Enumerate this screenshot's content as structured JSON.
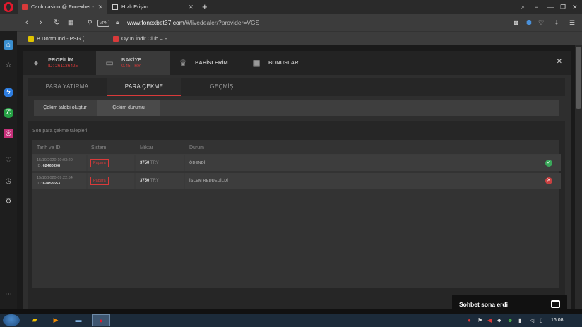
{
  "browser": {
    "tabs": [
      {
        "title": "Canlı casino @ Fonexbet -",
        "active": true
      },
      {
        "title": "Hızlı Erişim",
        "active": false
      }
    ],
    "url_host": "www.fonexbet37.com",
    "url_path": "/#/livedealer/?provider=VGS",
    "vpn_label": "VPN",
    "bookmarks": [
      "B.Dortmund - PSG (...",
      "Oyun İndir Club – F..."
    ]
  },
  "modal": {
    "tabs": [
      {
        "title": "PROFİLİM",
        "subtitle": "ID: 261136425",
        "icon": "user-icon"
      },
      {
        "title": "BAKİYE",
        "subtitle": "0.45 TRY",
        "icon": "wallet-icon"
      },
      {
        "title": "BAHİSLERİM",
        "subtitle": "",
        "icon": "trophy-icon"
      },
      {
        "title": "BONUSLAR",
        "subtitle": "",
        "icon": "gift-icon"
      }
    ],
    "close_label": "✕",
    "subtabs": [
      "PARA YATIRMA",
      "PARA ÇEKME",
      "GEÇMİŞ"
    ],
    "actions": [
      "Çekim talebi oluştur",
      "Çekim durumu"
    ],
    "section_title": "Son para çekme talepleri",
    "columns": [
      "Tarih ve ID",
      "Sistem",
      "Miktar",
      "Durum"
    ],
    "rows": [
      {
        "date": "15/10/2020-10:03:20",
        "id_prefix": "ID:",
        "id": "62460208",
        "system": "Papara",
        "amount": "3750",
        "currency": "TRY",
        "status": "ÖDENDİ",
        "status_type": "success"
      },
      {
        "date": "15/10/2020-09:22:54",
        "id_prefix": "ID:",
        "id": "62458553",
        "system": "Papara",
        "amount": "3750",
        "currency": "TRY",
        "status": "İŞLEM REDDEDİLDİ",
        "status_type": "rejected"
      }
    ]
  },
  "chat": {
    "label": "Sohbet sona erdi"
  },
  "taskbar": {
    "clock": "16:08"
  },
  "colors": {
    "accent": "#d93a3a",
    "success": "#3aa85a",
    "rejected": "#c94040",
    "panel": "#2e2e2e"
  }
}
